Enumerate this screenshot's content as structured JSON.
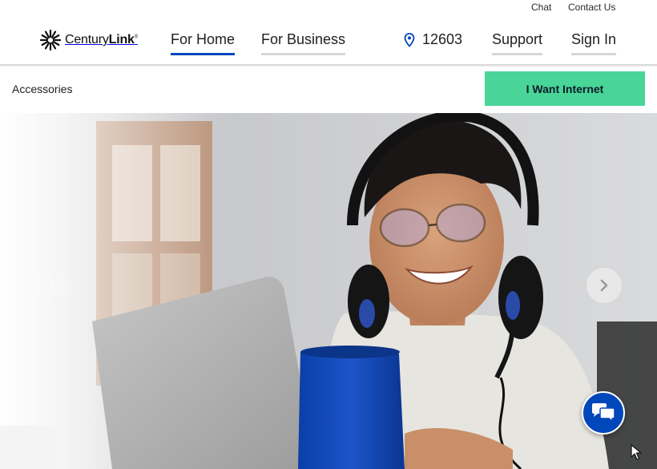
{
  "utility_nav": {
    "chat": "Chat",
    "contact": "Contact Us"
  },
  "brand": {
    "name_light": "Century",
    "name_bold": "Link",
    "mark": "®"
  },
  "nav": {
    "for_home": "For Home",
    "for_business": "For Business",
    "zip_code": "12603",
    "support": "Support",
    "sign_in": "Sign In"
  },
  "subbar": {
    "section": "Accessories",
    "cta_label": "I Want Internet"
  },
  "hero": {
    "image_subject": "young man with headset and glasses smiling at a laptop",
    "prev_icon": "chevron-left-icon",
    "next_icon": "chevron-right-icon"
  },
  "chat_widget": {
    "icon": "chat-bubbles-icon"
  },
  "colors": {
    "brand_blue": "#0047bb",
    "cta_green": "#48d597",
    "nav_underline_inactive": "#d7d7d7"
  }
}
